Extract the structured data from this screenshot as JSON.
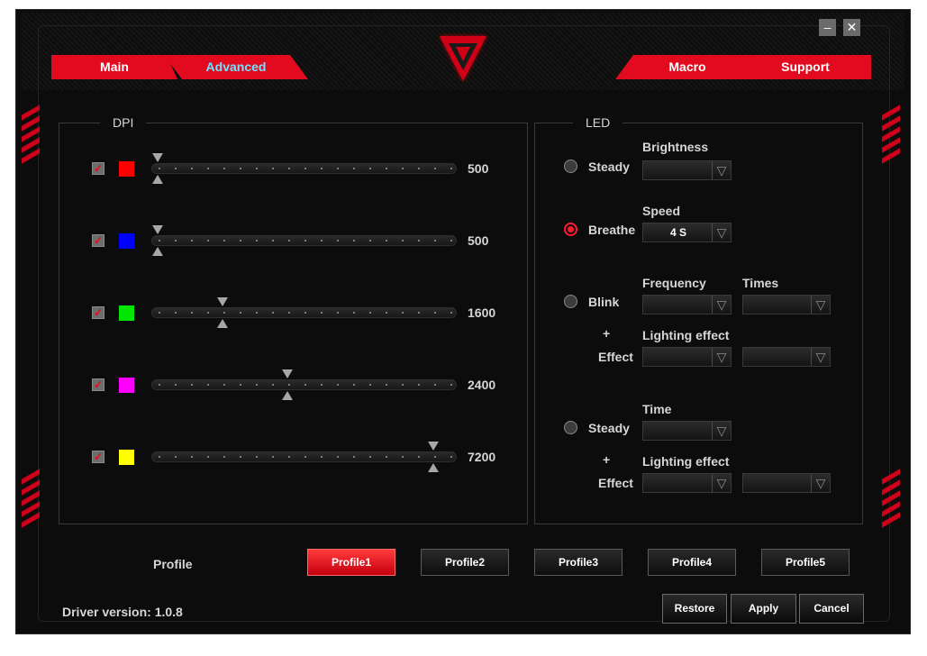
{
  "tabs": [
    {
      "label": "Main",
      "active": false
    },
    {
      "label": "Advanced",
      "active": true
    },
    {
      "label": "Macro",
      "active": false
    },
    {
      "label": "Support",
      "active": false
    }
  ],
  "window": {
    "minimize": "–",
    "close": "✕"
  },
  "dpi": {
    "title": "DPI",
    "levels": [
      {
        "checked": true,
        "color": "#ff0000",
        "value": "500"
      },
      {
        "checked": true,
        "color": "#0000ff",
        "value": "500"
      },
      {
        "checked": true,
        "color": "#00e600",
        "value": "1600"
      },
      {
        "checked": true,
        "color": "#ff00ff",
        "value": "2400"
      },
      {
        "checked": true,
        "color": "#ffff00",
        "value": "7200"
      }
    ]
  },
  "led": {
    "title": "LED",
    "steady": {
      "label": "Steady",
      "brightness_label": "Brightness",
      "brightness_value": ""
    },
    "breathe": {
      "label": "Breathe",
      "speed_label": "Speed",
      "speed_value": "4 S",
      "selected": true
    },
    "blink": {
      "label": "Blink",
      "frequency_label": "Frequency",
      "times_label": "Times",
      "plus": "+",
      "lighting_label": "Lighting effect",
      "effect_label": "Effect"
    },
    "steady2": {
      "label": "Steady",
      "time_label": "Time",
      "plus": "+",
      "lighting_label": "Lighting effect",
      "effect_label": "Effect"
    }
  },
  "profile": {
    "label": "Profile",
    "buttons": [
      "Profile1",
      "Profile2",
      "Profile3",
      "Profile4",
      "Profile5"
    ],
    "selected": "Profile1"
  },
  "footer": {
    "driver_version": "Driver version:  1.0.8",
    "restore": "Restore",
    "apply": "Apply",
    "cancel": "Cancel"
  },
  "colors": {
    "accent": "#e10a1e",
    "active_tab_text": "#6fe3ff"
  }
}
